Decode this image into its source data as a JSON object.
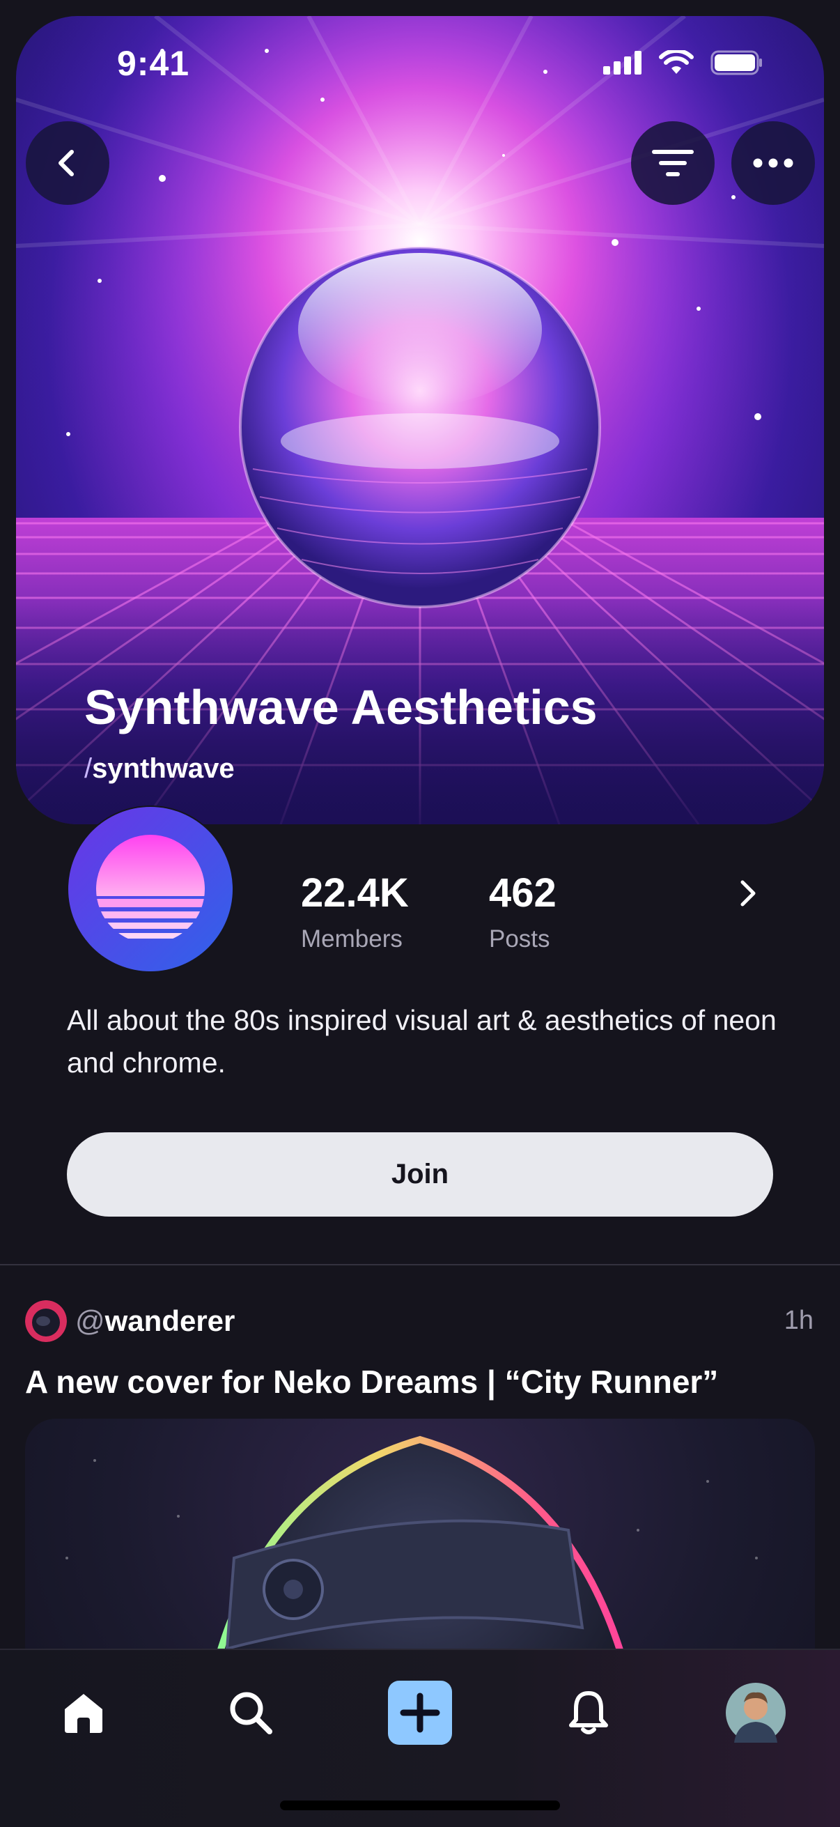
{
  "status_bar": {
    "time": "9:41"
  },
  "community": {
    "name": "Synthwave Aesthetics",
    "slug_prefix": "/",
    "slug": "synthwave",
    "members_count": "22.4K",
    "members_label": "Members",
    "posts_count": "462",
    "posts_label": "Posts",
    "description": "All about the 80s inspired visual art & aesthetics of neon and chrome.",
    "join_label": "Join"
  },
  "post": {
    "user_prefix": "@",
    "username": "wanderer",
    "time_ago": "1h",
    "title": "A new cover for Neko Dreams | “City Runner”"
  },
  "icons": {
    "back": "chevron-left-icon",
    "filter": "filter-icon",
    "more": "more-horizontal-icon",
    "home": "home-icon",
    "search": "search-icon",
    "create": "plus-icon",
    "notifications": "bell-icon",
    "profile": "profile-avatar"
  },
  "colors": {
    "background": "#15141d",
    "join_button": "#e8e9ee",
    "create_button": "#8ec8ff",
    "neon_pink": "#ff4fe0",
    "neon_purple": "#6a2cff"
  }
}
